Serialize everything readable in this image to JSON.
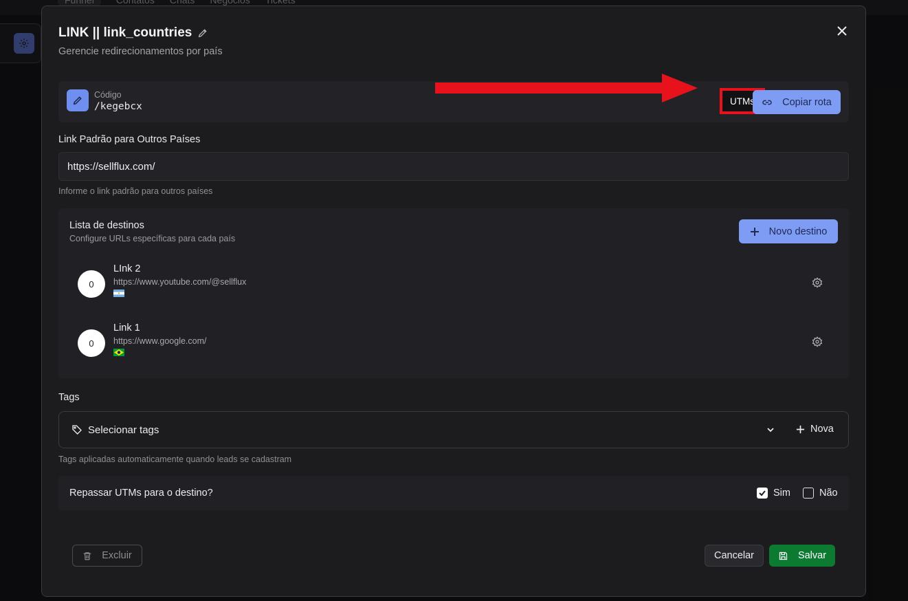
{
  "background": {
    "tabs": [
      "Funnel",
      "Contatos",
      "Chats",
      "Negócios",
      "Tickets"
    ]
  },
  "modal": {
    "title": "LINK || link_countries",
    "subtitle": "Gerencie redirecionamentos por país",
    "code": {
      "label": "Código",
      "value": "/kegebcx",
      "utms_button": "UTMs",
      "copy_button": "Copiar rota"
    },
    "default_link": {
      "label": "Link Padrão para Outros Países",
      "value": "https://sellflux.com/",
      "hint": "Informe o link padrão para outros países"
    },
    "destinations": {
      "title": "Lista de destinos",
      "subtitle": "Configure URLs específicas para cada país",
      "new_button": "Novo destino",
      "items": [
        {
          "name": "LInk 2",
          "url": "https://www.youtube.com/@sellflux",
          "count": "0",
          "flag": "argentina-flag"
        },
        {
          "name": "Link 1",
          "url": "https://www.google.com/",
          "count": "0",
          "flag": "brazil-flag"
        }
      ]
    },
    "tags": {
      "label": "Tags",
      "placeholder": "Selecionar tags",
      "new_button": "Nova",
      "hint": "Tags aplicadas automaticamente quando leads se cadastram"
    },
    "utm_pass": {
      "question": "Repassar UTMs para o destino?",
      "yes_label": "Sim",
      "yes_checked": true,
      "no_label": "Não",
      "no_checked": false
    },
    "footer": {
      "delete_button": "Excluir",
      "cancel_button": "Cancelar",
      "save_button": "Salvar"
    }
  },
  "colors": {
    "accent": "#7f9cf5",
    "save_green": "#0d7a32",
    "highlight_red": "#e8121c"
  }
}
